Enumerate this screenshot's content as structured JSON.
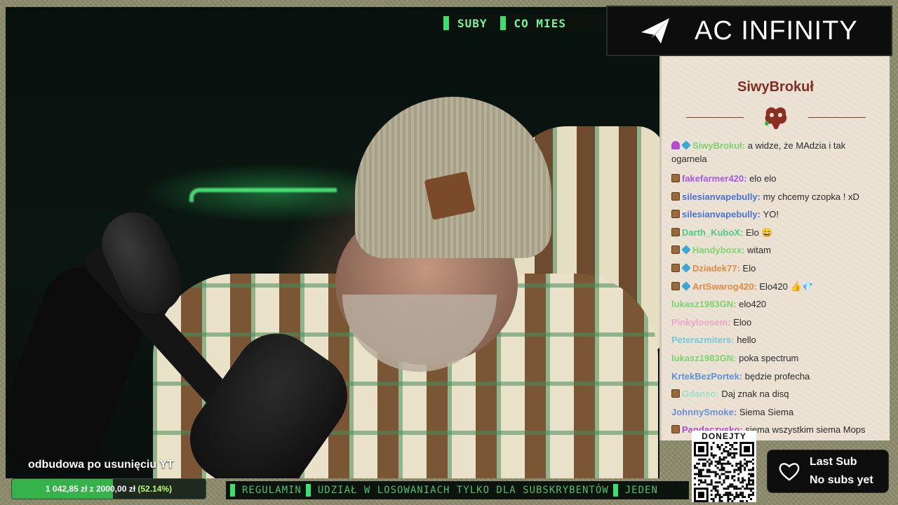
{
  "top_ticker": {
    "segments": [
      "SUBY",
      "CO MIES"
    ]
  },
  "sponsor": {
    "name": "AC INFINITY",
    "icon": "paper-plane-logo-icon"
  },
  "chat": {
    "channel_name": "SiwyBrokuł",
    "emblem_icon": "mushroom-emblem-icon",
    "messages": [
      {
        "user": "SiwyBrokuł",
        "user_color": "#7dd46e",
        "badges": [
          "mic",
          "mod"
        ],
        "text": "a widze, że MAdzia i tak ogarnela"
      },
      {
        "user": "fakefarmer420",
        "user_color": "#a05be0",
        "badges": [
          "sub"
        ],
        "text": "elo elo"
      },
      {
        "user": "silesianvapebully",
        "user_color": "#4a72d8",
        "badges": [
          "sub"
        ],
        "text": "my chcemy czopka ! xD"
      },
      {
        "user": "silesianvapebully",
        "user_color": "#4a72d8",
        "badges": [
          "sub"
        ],
        "text": "YO!"
      },
      {
        "user": "Darth_KuboX",
        "user_color": "#4cc98a",
        "badges": [
          "sub"
        ],
        "text": "Elo 😄"
      },
      {
        "user": "Handyboxx",
        "user_color": "#7dd46e",
        "badges": [
          "sub",
          "mod"
        ],
        "text": "witam"
      },
      {
        "user": "Dziadek77",
        "user_color": "#e28a45",
        "badges": [
          "sub",
          "mod"
        ],
        "text": "Elo"
      },
      {
        "user": "ArtSwarog420",
        "user_color": "#e28a45",
        "badges": [
          "sub",
          "mod"
        ],
        "text": "Elo420 👍💎"
      },
      {
        "user": "lukasz1983GN",
        "user_color": "#7dd46e",
        "badges": [],
        "text": "elo420"
      },
      {
        "user": "Pinkyloosem",
        "user_color": "#e8a7c6",
        "badges": [],
        "text": "Eloo"
      },
      {
        "user": "Peterazmiters",
        "user_color": "#76c9d6",
        "badges": [],
        "text": "hello"
      },
      {
        "user": "lukasz1983GN",
        "user_color": "#7dd46e",
        "badges": [],
        "text": "poka spectrum"
      },
      {
        "user": "KrtekBezPortek",
        "user_color": "#5b8fd8",
        "badges": [],
        "text": "będzie profecha"
      },
      {
        "user": "Gdanso",
        "user_color": "#9fe0c8",
        "badges": [
          "sub"
        ],
        "text": "Daj znak na disq"
      },
      {
        "user": "JohnnySmoke",
        "user_color": "#6b8fd8",
        "badges": [],
        "text": "Siema Siema"
      },
      {
        "user": "Pandaczysko",
        "user_color": "#b14ad6",
        "badges": [
          "sub"
        ],
        "text": "siema wszystkim siema Mops"
      }
    ]
  },
  "goal": {
    "label": "odbudowa po usunięciu YT",
    "current": "1 042,85 zł",
    "separator": "z",
    "target": "2000,00 zł",
    "percent_text": "(52.14%)",
    "progress_fraction": 0.5214
  },
  "bottom_ticker": {
    "segments": [
      "REGULAMIN",
      "UDZIAŁ W LOSOWANIACH TYLKO DLA SUBSKRYBENTÓW",
      "JEDEN"
    ]
  },
  "qr": {
    "title": "DONEJTY"
  },
  "last_sub": {
    "title": "Last Sub",
    "value": "No subs yet",
    "icon": "heart-icon"
  },
  "colors": {
    "neon": "#56ff86",
    "ticker_text": "#72f59c",
    "chat_bg": "#ebe2d4",
    "channel_name": "#7e2e24",
    "goal_fill": "#36b24a"
  }
}
